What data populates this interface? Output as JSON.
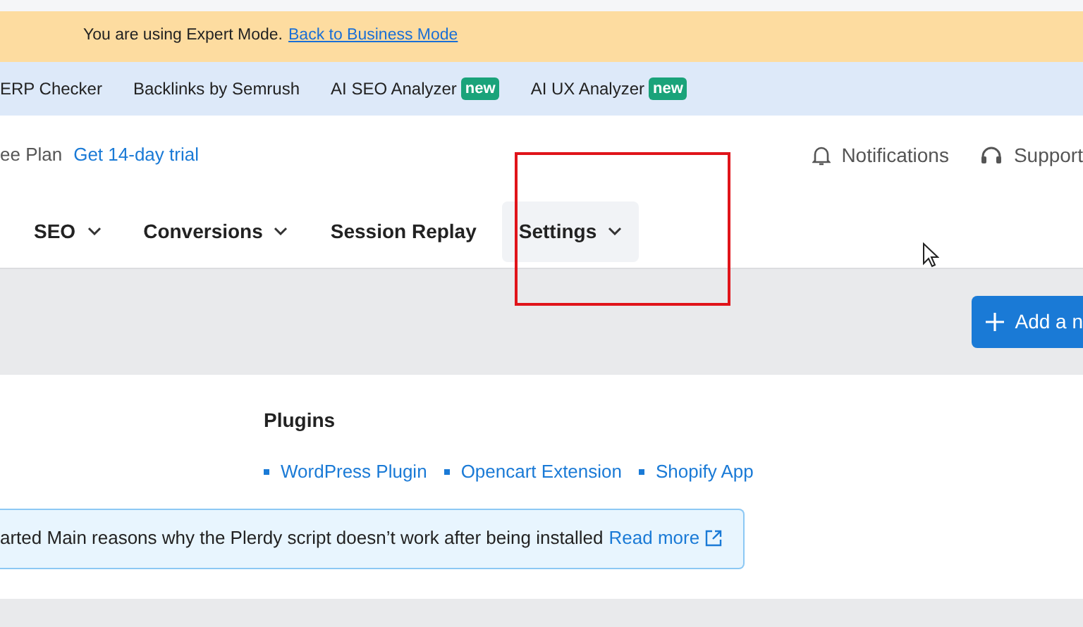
{
  "mode_banner": {
    "text": "You are using Expert Mode.",
    "link": "Back to Business Mode"
  },
  "tools_bar": [
    {
      "label": "ERP Checker"
    },
    {
      "label": "Backlinks by Semrush"
    },
    {
      "label": "AI SEO Analyzer",
      "badge": "new"
    },
    {
      "label": "AI UX Analyzer",
      "badge": "new"
    }
  ],
  "plan": {
    "label": "ee Plan",
    "link": "Get 14-day trial"
  },
  "header_actions": [
    {
      "kind": "bell",
      "label": "Notifications"
    },
    {
      "kind": "headset",
      "label": "Support"
    }
  ],
  "nav": [
    {
      "label": "SEO",
      "dropdown": true,
      "selected": false
    },
    {
      "label": "Conversions",
      "dropdown": true,
      "selected": false
    },
    {
      "label": "Session Replay",
      "dropdown": false,
      "selected": false
    },
    {
      "label": "Settings",
      "dropdown": true,
      "selected": true
    }
  ],
  "add_button": "Add a n",
  "plugins": {
    "title": "Plugins",
    "links": [
      "WordPress Plugin",
      "Opencart Extension",
      "Shopify App"
    ]
  },
  "notice": {
    "text": "arted Main reasons why the Plerdy script doesn’t work after being installed",
    "link": "Read more"
  },
  "highlight_frame": true,
  "pointer_cursor": true
}
